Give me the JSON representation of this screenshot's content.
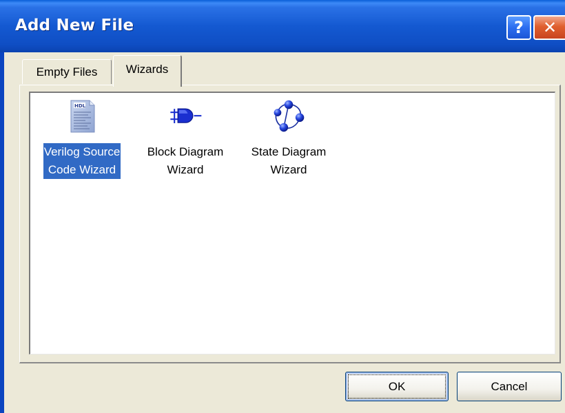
{
  "window": {
    "title": "Add New File",
    "help_button_label": "?",
    "close_button_label": "✕"
  },
  "tabs": [
    {
      "label": "Empty Files",
      "active": false
    },
    {
      "label": "Wizards",
      "active": true
    }
  ],
  "wizards": [
    {
      "label": "Verilog Source\nCode Wizard",
      "icon": "hdl-document-icon",
      "selected": true
    },
    {
      "label": "Block Diagram\nWizard",
      "icon": "logic-gate-icon",
      "selected": false
    },
    {
      "label": "State Diagram\nWizard",
      "icon": "state-machine-icon",
      "selected": false
    }
  ],
  "buttons": {
    "ok_label": "OK",
    "cancel_label": "Cancel"
  },
  "colors": {
    "titlebar": "#1459d1",
    "selection": "#316ac5",
    "dialog_face": "#ece9d8"
  }
}
